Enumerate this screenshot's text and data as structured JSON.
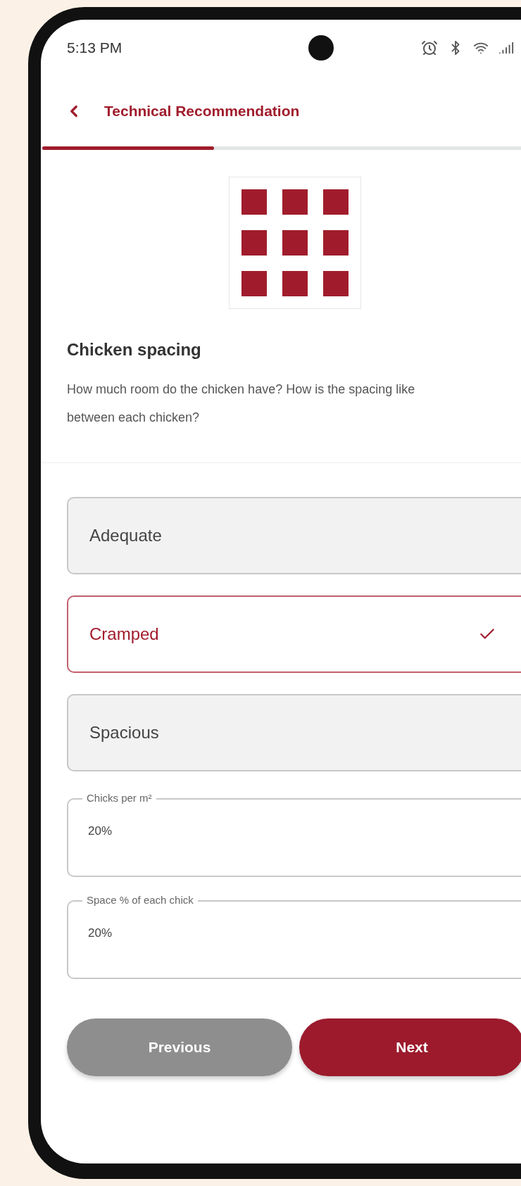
{
  "status_bar": {
    "time": "5:13 PM"
  },
  "header": {
    "title": "Technical Recommendation"
  },
  "progress": {
    "level": 0.33
  },
  "question": {
    "title": "Chicken spacing",
    "description": "How much room do the chicken have? How is the spacing like between each chicken?"
  },
  "options": [
    {
      "label": "Adequate",
      "selected": false
    },
    {
      "label": "Cramped",
      "selected": true
    },
    {
      "label": "Spacious",
      "selected": false
    }
  ],
  "fields": [
    {
      "label": "Chicks per m²",
      "value": "20%"
    },
    {
      "label": "Space % of each chick",
      "value": "20%"
    }
  ],
  "buttons": [
    {
      "label": "Previous",
      "kind": "secondary"
    },
    {
      "label": "Next",
      "kind": "primary"
    }
  ]
}
